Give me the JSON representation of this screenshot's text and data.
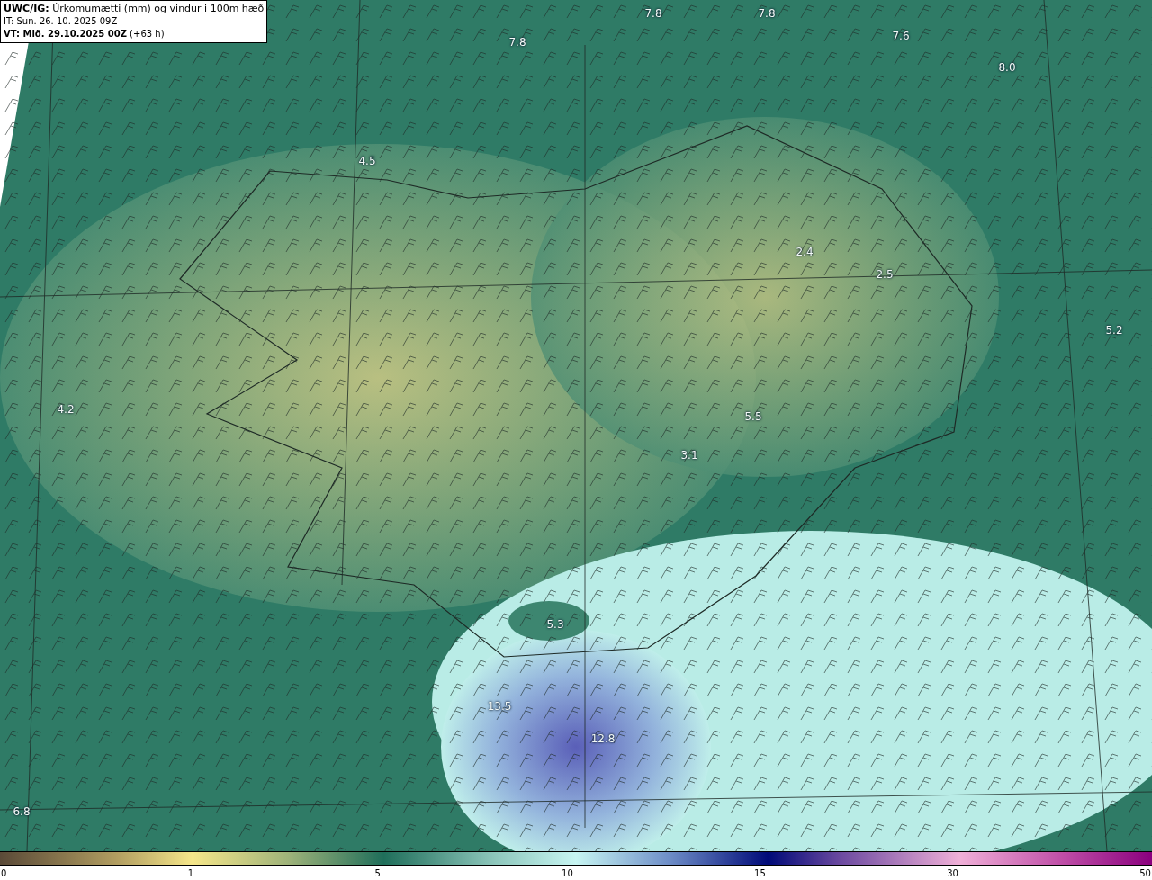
{
  "title_box": {
    "lines": [
      "**UWC/IG:** Úrkomumætti (mm) og vindur i 100m hæð",
      "IT: Sun. 26. 10. 2025 09Z",
      "**VT: Mið. 29.10.2025 00Z** (+63 h)"
    ]
  },
  "map": {
    "value_labels": [
      "7.8",
      "7.8",
      "7.8",
      "7.6",
      "8.0",
      "4.5",
      "2.4",
      "2.5",
      "5.2",
      "4.2",
      "5.5",
      "3.1",
      "5.3",
      "13.5",
      "12.8",
      "6.8"
    ]
  },
  "colorbar": {
    "ticks": [
      "0",
      "1",
      "5",
      "10",
      "15",
      "30",
      "50"
    ]
  }
}
